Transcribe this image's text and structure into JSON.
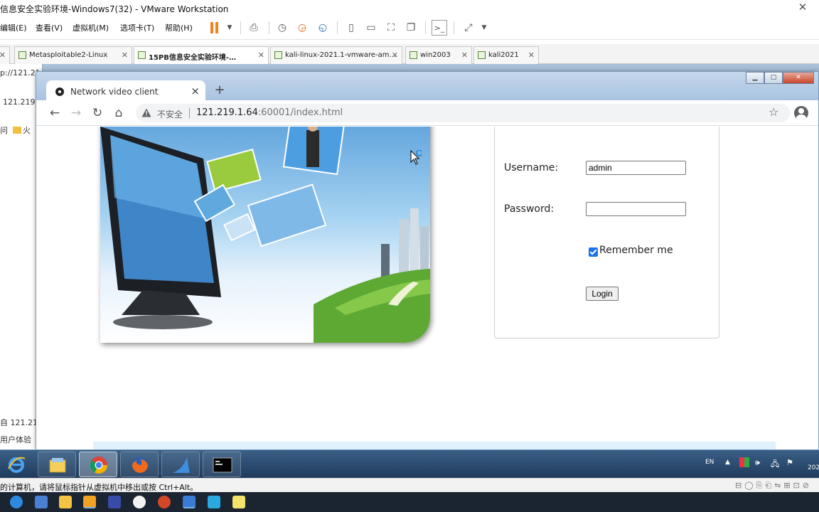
{
  "vmware": {
    "title": "信息安全实验环境-Windows7(32) - VMware Workstation",
    "close_glyph": "✕",
    "menu": [
      "编辑(E)",
      "查看(V)",
      "虚拟机(M)",
      "选项卡(T)",
      "帮助(H)"
    ],
    "tabs": [
      {
        "label": "Metasploitable2-Linux",
        "active": false
      },
      {
        "label": "15PB信息安全实验环境-…",
        "active": true
      },
      {
        "label": "kali-linux-2021.1-vmware-am…",
        "active": false
      },
      {
        "label": "win2003",
        "active": false
      },
      {
        "label": "kali2021",
        "active": false
      }
    ],
    "status_text": "的计算机，请将鼠标指针从虚拟机中移出或按 Ctrl+Alt。"
  },
  "background_window": {
    "url_fragment": "p://121.21",
    "addr_fragment": "121.219.",
    "bookmark_fragment": "问",
    "folder_fragment": "火",
    "item_fragment": "自 121.21",
    "bottom_fragment": "用户体验"
  },
  "browser": {
    "tab_title": "Network video client",
    "tab_close": "×",
    "new_tab": "+",
    "insecure_label": "不安全",
    "url_host": "121.219.1.64",
    "url_rest": ":60001/index.html",
    "icons": {
      "back": "back-arrow-icon",
      "forward": "forward-arrow-icon",
      "reload": "reload-icon",
      "home": "home-icon",
      "warning": "warning-triangle-icon",
      "bookmark": "star-icon",
      "profile": "profile-icon"
    }
  },
  "login": {
    "username_label": "Username:",
    "username_value": "admin",
    "password_label": "Password:",
    "password_value": "",
    "remember_label": "Remember me",
    "remember_checked": true,
    "login_button": "Login"
  },
  "taskbar": {
    "lang": "EN",
    "clock_fragment": "202"
  },
  "colors": {
    "accent_orange": "#f0841a",
    "checkbox_blue": "#1a73e8",
    "light_blue_panel": "#dff1fb",
    "taskbar_blue": "#2b4b6f"
  }
}
